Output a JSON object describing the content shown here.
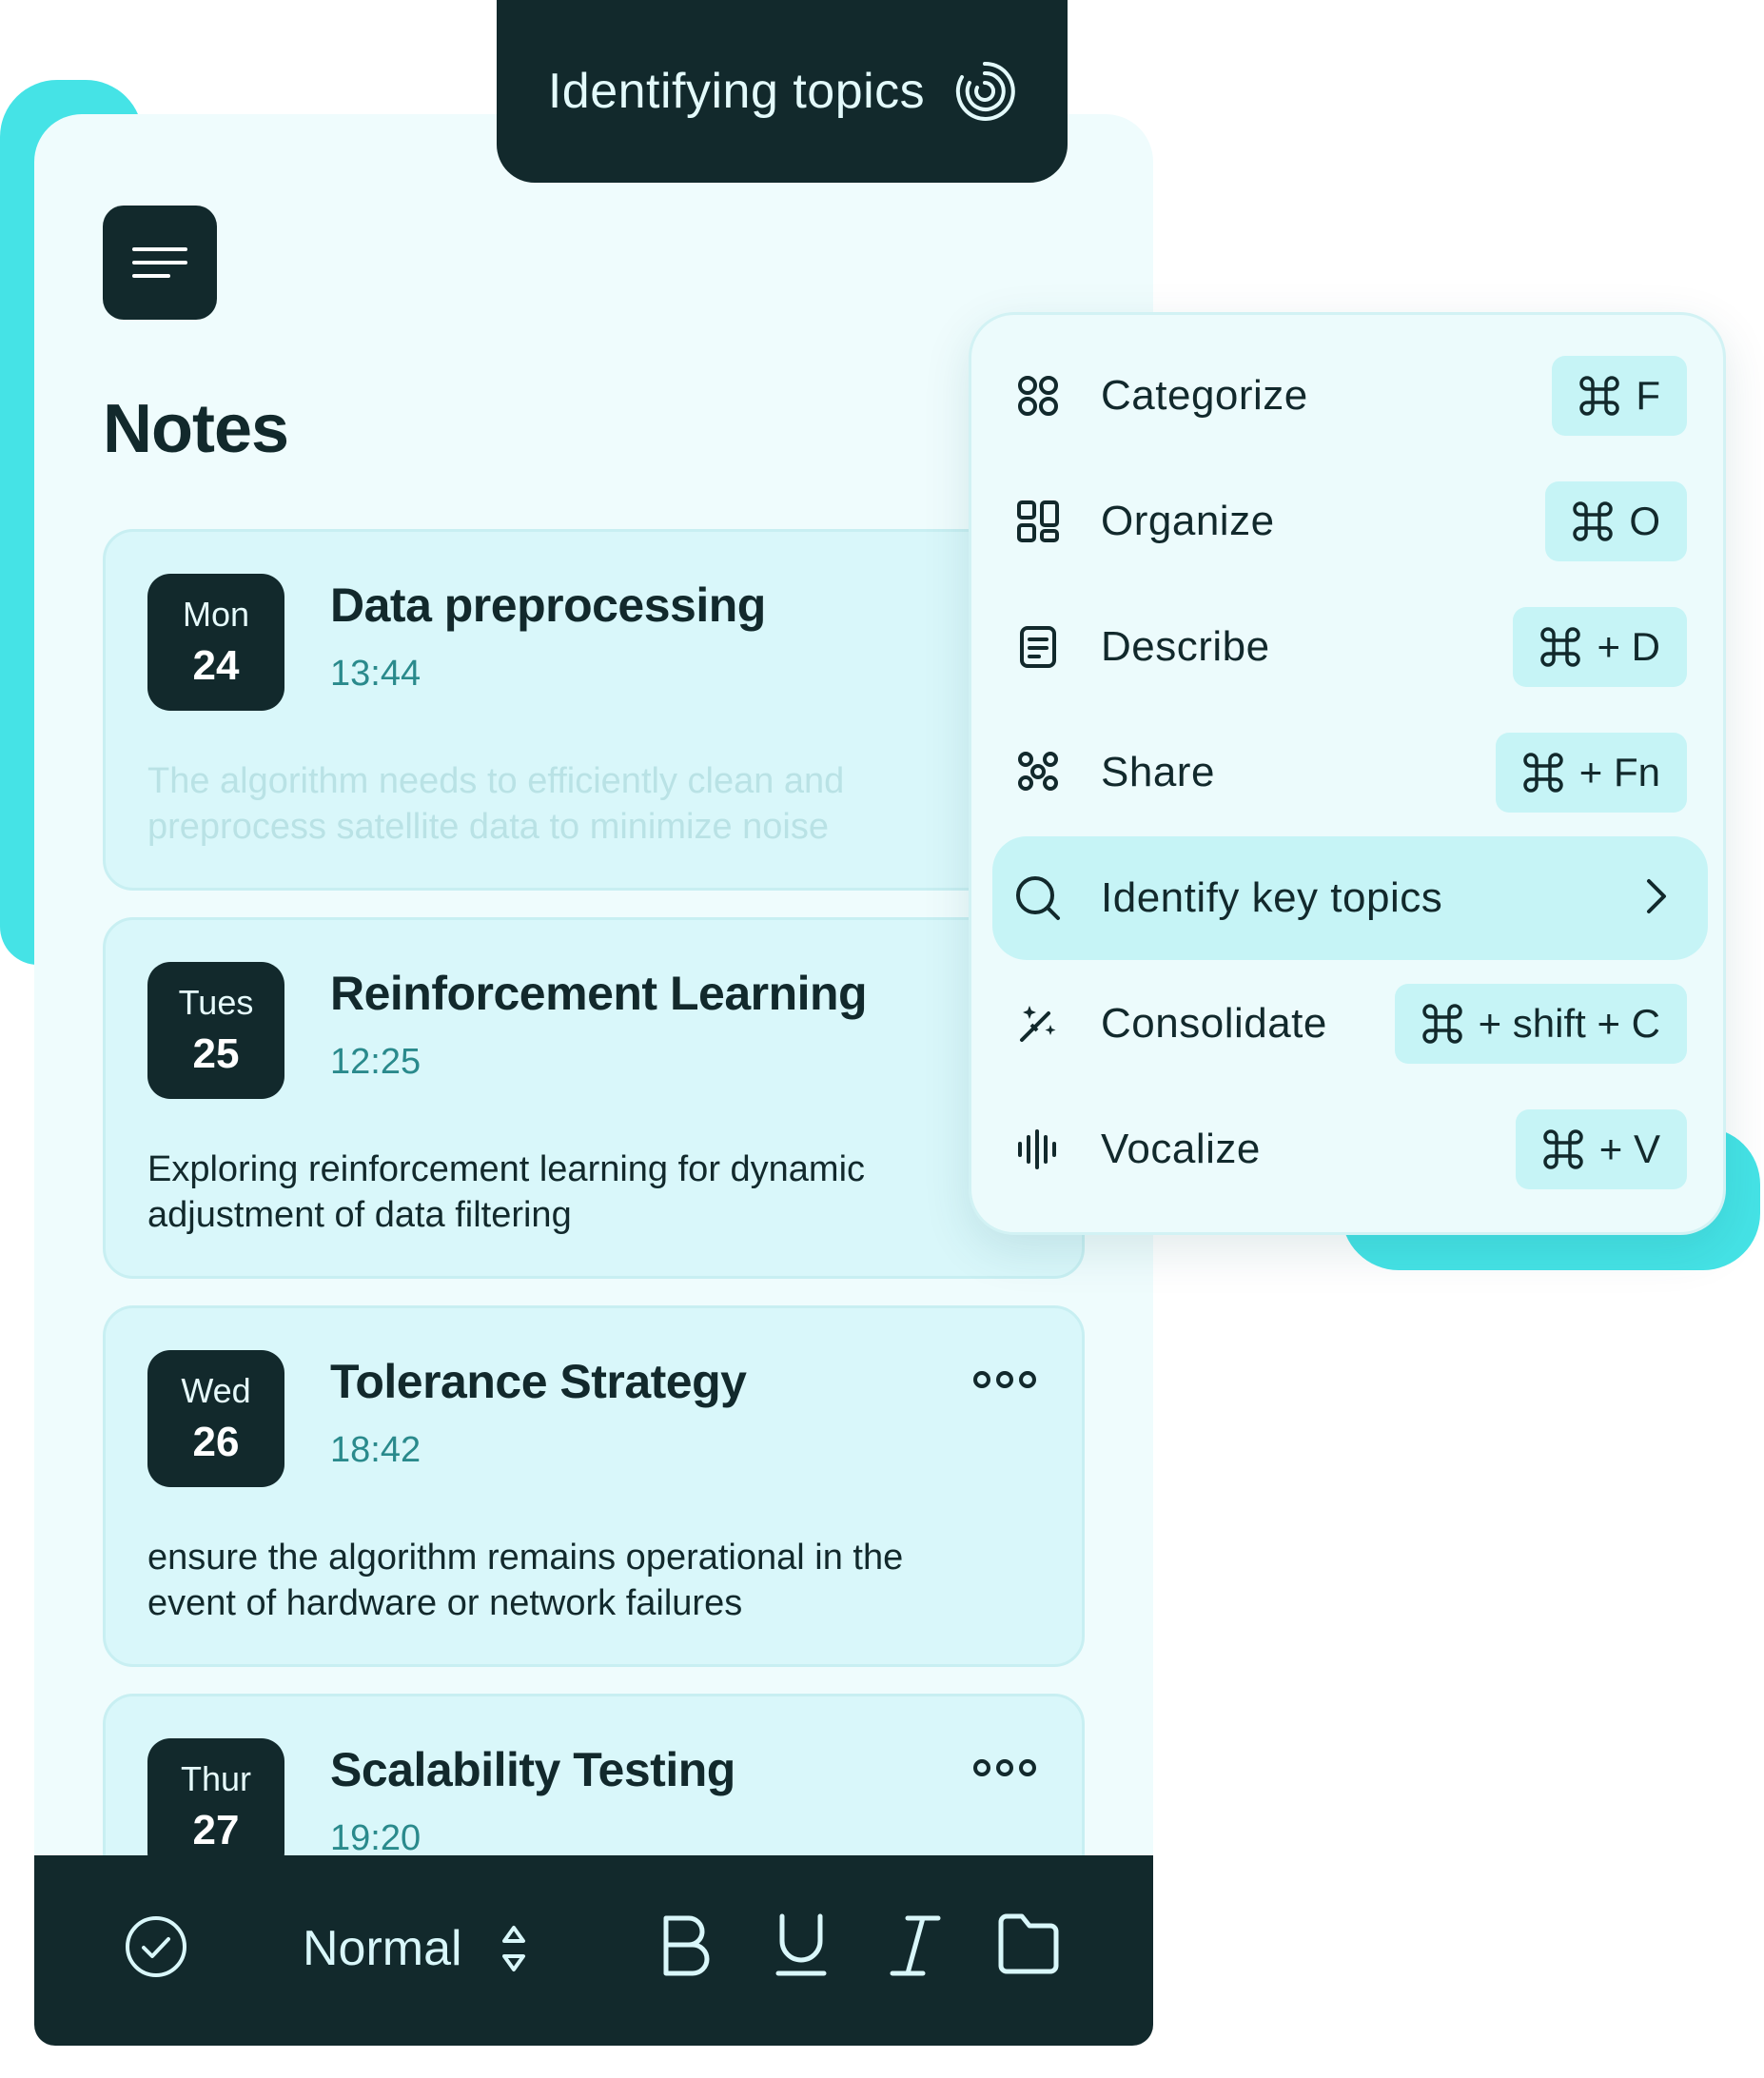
{
  "status": {
    "text": "Identifying topics"
  },
  "page": {
    "title": "Notes"
  },
  "notes": [
    {
      "day": "Mon",
      "date": "24",
      "title": "Data preprocessing",
      "time": "13:44",
      "body": "The algorithm needs to efficiently clean and preprocess satellite data to minimize noise"
    },
    {
      "day": "Tues",
      "date": "25",
      "title": "Reinforcement Learning",
      "time": "12:25",
      "body": "Exploring reinforcement learning for dynamic adjustment of data filtering"
    },
    {
      "day": "Wed",
      "date": "26",
      "title": "Tolerance Strategy",
      "time": "18:42",
      "body": "ensure the algorithm remains operational in the event of hardware or network failures"
    },
    {
      "day": "Thur",
      "date": "27",
      "title": "Scalability Testing",
      "time": "19:20",
      "body": ""
    }
  ],
  "menu": {
    "items": [
      {
        "label": "Categorize",
        "icon": "grid-circles-icon",
        "shortcut": "F"
      },
      {
        "label": "Organize",
        "icon": "layout-icon",
        "shortcut": "O"
      },
      {
        "label": "Describe",
        "icon": "document-icon",
        "shortcut": "+ D"
      },
      {
        "label": "Share",
        "icon": "people-icon",
        "shortcut": "+ Fn"
      },
      {
        "label": "Identify key topics",
        "icon": "search-icon",
        "shortcut": ""
      },
      {
        "label": "Consolidate",
        "icon": "magic-wand-icon",
        "shortcut": "+ shift + C"
      },
      {
        "label": "Vocalize",
        "icon": "soundwave-icon",
        "shortcut": "+ V"
      }
    ]
  },
  "toolbar": {
    "style_value": "Normal"
  },
  "colors": {
    "dark": "#12292c",
    "accent": "#45e3e6",
    "card": "#d9f7fa",
    "time": "#2a8a8c"
  }
}
